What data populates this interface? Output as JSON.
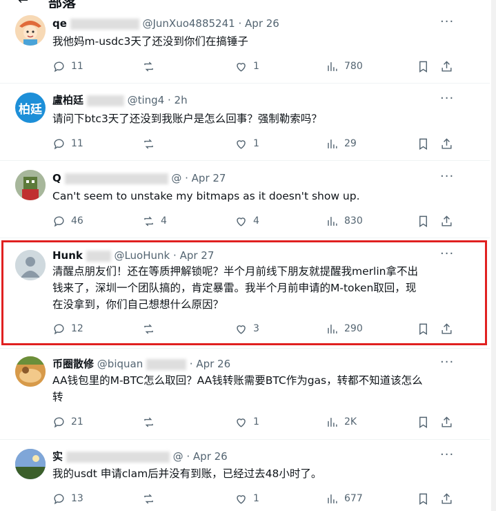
{
  "header": {
    "title": "部落"
  },
  "tweets": [
    {
      "name": "qe",
      "handle": "@JunXuo4885241",
      "time": "Apr 26",
      "text": [
        "我他妈m-usdc3天了还没到你们在搞锤子"
      ],
      "replies": "11",
      "reposts": "",
      "likes": "1",
      "views": "780"
    },
    {
      "name": "盧柏廷",
      "handle": "@ting4",
      "time": "2h",
      "avatar_text": "柏廷",
      "text": [
        "请问下btc3天了还没到我账户是怎么回事？强制勒索吗？"
      ],
      "replies": "11",
      "reposts": "",
      "likes": "1",
      "views": "29"
    },
    {
      "name": "Q",
      "handle": "@",
      "time": "Apr 27",
      "text": [
        "Can't seem to unstake my bitmaps as it doesn't show up."
      ],
      "replies": "46",
      "reposts": "4",
      "likes": "4",
      "views": "830"
    },
    {
      "name": "Hunk",
      "handle": "@LuoHunk",
      "time": "Apr 27",
      "text": [
        "清醒点朋友们！还在等质押解锁呢？半个月前线下朋友就提醒我merlin拿不出",
        "钱来了，深圳一个团队搞的，肯定暴雷。我半个月前申请的M-token取回，现",
        "在没拿到，你们自己想想什么原因？"
      ],
      "replies": "12",
      "reposts": "",
      "likes": "3",
      "views": "290"
    },
    {
      "name": "币圈散修",
      "handle": "@biquan",
      "time": "Apr 26",
      "text": [
        "AA钱包里的M-BTC怎么取回？AA钱转账需要BTC作为gas，转都不知道该怎么",
        "转"
      ],
      "replies": "21",
      "reposts": "",
      "likes": "1",
      "views": "2K"
    },
    {
      "name": "实",
      "handle": "@",
      "time": "Apr 26",
      "text": [
        "我的usdt 申请clam后并没有到账，已经过去48小时了。"
      ],
      "replies": "13",
      "reposts": "",
      "likes": "1",
      "views": "677"
    }
  ],
  "colors": {
    "accent_red": "#e02020",
    "muted": "#536471",
    "blue_avatar": "#1d8fd8"
  },
  "icons": [
    "reply-icon",
    "repost-icon",
    "like-icon",
    "views-icon",
    "bookmark-icon",
    "share-icon",
    "more-icon"
  ]
}
